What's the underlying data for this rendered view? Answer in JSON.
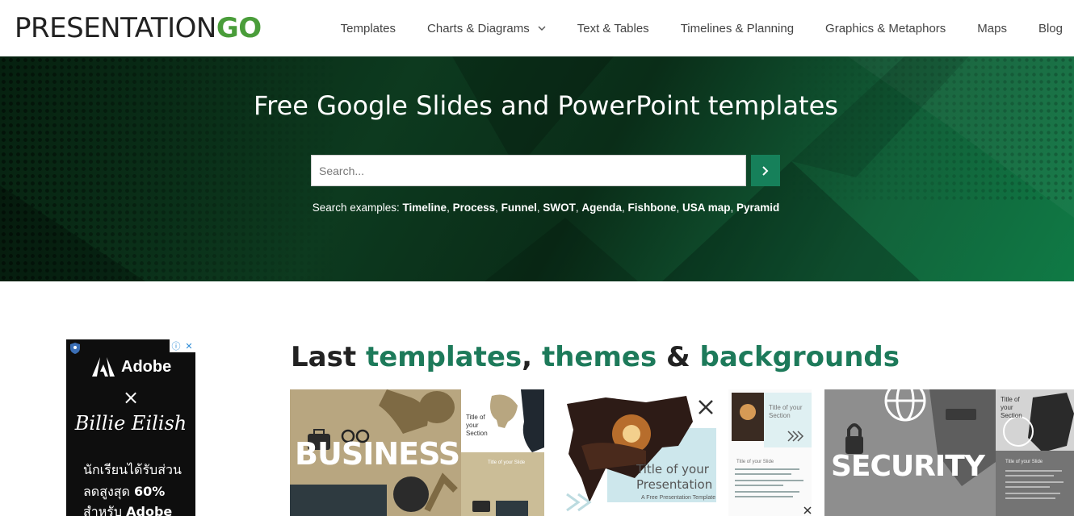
{
  "header": {
    "logo_main": "PRESENTATION",
    "logo_accent": "GO",
    "nav": [
      {
        "label": "Templates"
      },
      {
        "label": "Charts & Diagrams",
        "has_dropdown": true
      },
      {
        "label": "Text & Tables"
      },
      {
        "label": "Timelines & Planning"
      },
      {
        "label": "Graphics & Metaphors"
      },
      {
        "label": "Maps"
      },
      {
        "label": "Blog"
      }
    ]
  },
  "hero": {
    "title": "Free Google Slides and PowerPoint templates",
    "search_placeholder": "Search...",
    "examples_label": "Search examples:",
    "examples": [
      "Timeline",
      "Process",
      "Funnel",
      "SWOT",
      "Agenda",
      "Fishbone",
      "USA map",
      "Pyramid"
    ]
  },
  "ad": {
    "brand": "Adobe",
    "times": "×",
    "artist": "Billie Eilish",
    "line1": "นักเรียนได้รับส่วน",
    "line2_prefix": "ลดสูงสุด",
    "line2_bold": "60%",
    "line3_prefix": "สำหรับ",
    "line3_bold": "Adobe"
  },
  "section": {
    "prefix": "Last ",
    "word1": "templates",
    "sep1": ", ",
    "word2": "themes",
    "sep2": " & ",
    "word3": "backgrounds"
  },
  "cards": [
    {
      "big_text": "BUSINESS",
      "side_title": "Title of your Section",
      "side_small_title": "Title of your Slide"
    },
    {
      "title_line1": "Title of your",
      "title_line2": "Presentation",
      "subtitle": "A Free Presentation Template",
      "side_title": "Title of your Section",
      "side_small_title": "Title of your Slide"
    },
    {
      "big_text": "SECURITY",
      "side_title": "Title of your Section",
      "side_small_title": "Title of your Slide"
    }
  ],
  "colors": {
    "brand_green": "#16805a",
    "logo_green": "#4a9d3a",
    "heading_green": "#1d7a5a"
  }
}
